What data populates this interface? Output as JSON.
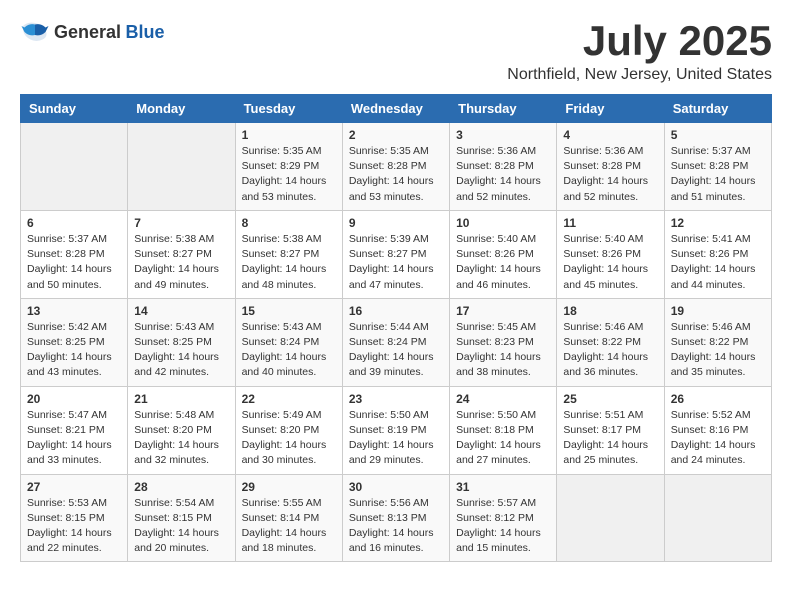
{
  "header": {
    "logo_general": "General",
    "logo_blue": "Blue",
    "month_title": "July 2025",
    "location": "Northfield, New Jersey, United States"
  },
  "weekdays": [
    "Sunday",
    "Monday",
    "Tuesday",
    "Wednesday",
    "Thursday",
    "Friday",
    "Saturday"
  ],
  "weeks": [
    [
      {
        "day": "",
        "content": ""
      },
      {
        "day": "",
        "content": ""
      },
      {
        "day": "1",
        "content": "Sunrise: 5:35 AM\nSunset: 8:29 PM\nDaylight: 14 hours and 53 minutes."
      },
      {
        "day": "2",
        "content": "Sunrise: 5:35 AM\nSunset: 8:28 PM\nDaylight: 14 hours and 53 minutes."
      },
      {
        "day": "3",
        "content": "Sunrise: 5:36 AM\nSunset: 8:28 PM\nDaylight: 14 hours and 52 minutes."
      },
      {
        "day": "4",
        "content": "Sunrise: 5:36 AM\nSunset: 8:28 PM\nDaylight: 14 hours and 52 minutes."
      },
      {
        "day": "5",
        "content": "Sunrise: 5:37 AM\nSunset: 8:28 PM\nDaylight: 14 hours and 51 minutes."
      }
    ],
    [
      {
        "day": "6",
        "content": "Sunrise: 5:37 AM\nSunset: 8:28 PM\nDaylight: 14 hours and 50 minutes."
      },
      {
        "day": "7",
        "content": "Sunrise: 5:38 AM\nSunset: 8:27 PM\nDaylight: 14 hours and 49 minutes."
      },
      {
        "day": "8",
        "content": "Sunrise: 5:38 AM\nSunset: 8:27 PM\nDaylight: 14 hours and 48 minutes."
      },
      {
        "day": "9",
        "content": "Sunrise: 5:39 AM\nSunset: 8:27 PM\nDaylight: 14 hours and 47 minutes."
      },
      {
        "day": "10",
        "content": "Sunrise: 5:40 AM\nSunset: 8:26 PM\nDaylight: 14 hours and 46 minutes."
      },
      {
        "day": "11",
        "content": "Sunrise: 5:40 AM\nSunset: 8:26 PM\nDaylight: 14 hours and 45 minutes."
      },
      {
        "day": "12",
        "content": "Sunrise: 5:41 AM\nSunset: 8:26 PM\nDaylight: 14 hours and 44 minutes."
      }
    ],
    [
      {
        "day": "13",
        "content": "Sunrise: 5:42 AM\nSunset: 8:25 PM\nDaylight: 14 hours and 43 minutes."
      },
      {
        "day": "14",
        "content": "Sunrise: 5:43 AM\nSunset: 8:25 PM\nDaylight: 14 hours and 42 minutes."
      },
      {
        "day": "15",
        "content": "Sunrise: 5:43 AM\nSunset: 8:24 PM\nDaylight: 14 hours and 40 minutes."
      },
      {
        "day": "16",
        "content": "Sunrise: 5:44 AM\nSunset: 8:24 PM\nDaylight: 14 hours and 39 minutes."
      },
      {
        "day": "17",
        "content": "Sunrise: 5:45 AM\nSunset: 8:23 PM\nDaylight: 14 hours and 38 minutes."
      },
      {
        "day": "18",
        "content": "Sunrise: 5:46 AM\nSunset: 8:22 PM\nDaylight: 14 hours and 36 minutes."
      },
      {
        "day": "19",
        "content": "Sunrise: 5:46 AM\nSunset: 8:22 PM\nDaylight: 14 hours and 35 minutes."
      }
    ],
    [
      {
        "day": "20",
        "content": "Sunrise: 5:47 AM\nSunset: 8:21 PM\nDaylight: 14 hours and 33 minutes."
      },
      {
        "day": "21",
        "content": "Sunrise: 5:48 AM\nSunset: 8:20 PM\nDaylight: 14 hours and 32 minutes."
      },
      {
        "day": "22",
        "content": "Sunrise: 5:49 AM\nSunset: 8:20 PM\nDaylight: 14 hours and 30 minutes."
      },
      {
        "day": "23",
        "content": "Sunrise: 5:50 AM\nSunset: 8:19 PM\nDaylight: 14 hours and 29 minutes."
      },
      {
        "day": "24",
        "content": "Sunrise: 5:50 AM\nSunset: 8:18 PM\nDaylight: 14 hours and 27 minutes."
      },
      {
        "day": "25",
        "content": "Sunrise: 5:51 AM\nSunset: 8:17 PM\nDaylight: 14 hours and 25 minutes."
      },
      {
        "day": "26",
        "content": "Sunrise: 5:52 AM\nSunset: 8:16 PM\nDaylight: 14 hours and 24 minutes."
      }
    ],
    [
      {
        "day": "27",
        "content": "Sunrise: 5:53 AM\nSunset: 8:15 PM\nDaylight: 14 hours and 22 minutes."
      },
      {
        "day": "28",
        "content": "Sunrise: 5:54 AM\nSunset: 8:15 PM\nDaylight: 14 hours and 20 minutes."
      },
      {
        "day": "29",
        "content": "Sunrise: 5:55 AM\nSunset: 8:14 PM\nDaylight: 14 hours and 18 minutes."
      },
      {
        "day": "30",
        "content": "Sunrise: 5:56 AM\nSunset: 8:13 PM\nDaylight: 14 hours and 16 minutes."
      },
      {
        "day": "31",
        "content": "Sunrise: 5:57 AM\nSunset: 8:12 PM\nDaylight: 14 hours and 15 minutes."
      },
      {
        "day": "",
        "content": ""
      },
      {
        "day": "",
        "content": ""
      }
    ]
  ]
}
